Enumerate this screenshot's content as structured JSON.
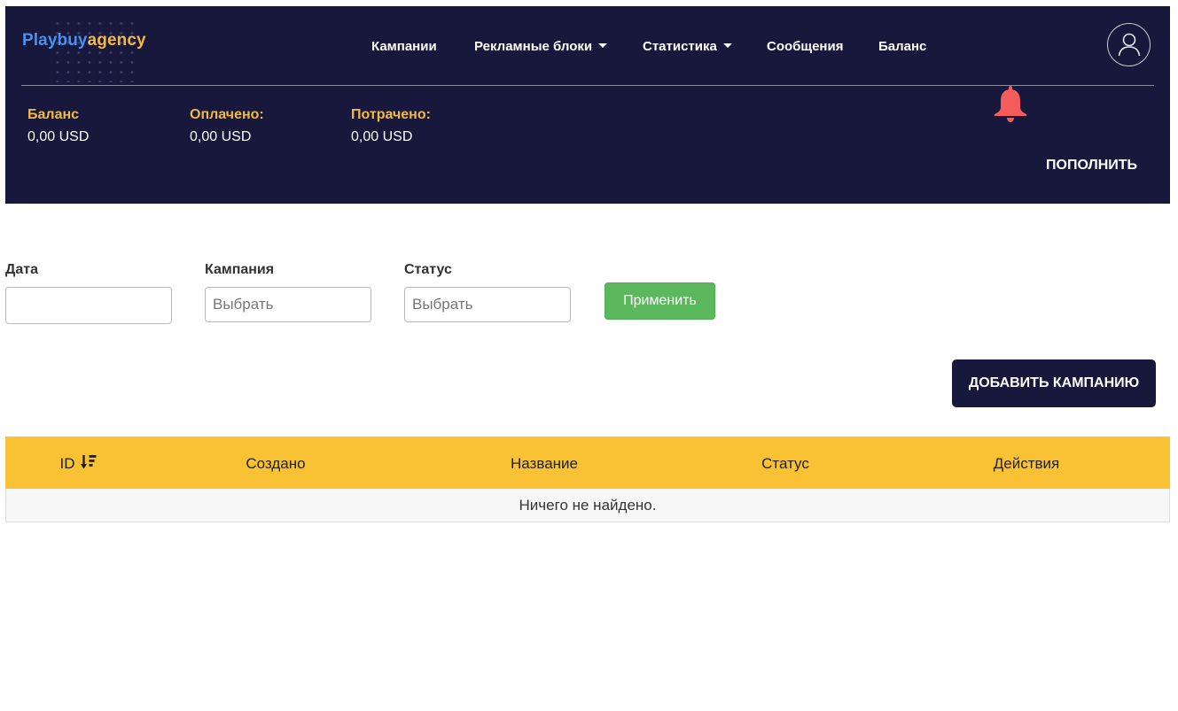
{
  "header": {
    "logo_part1": "Playbuy",
    "logo_part2": "agency",
    "nav": [
      {
        "label": "Кампании",
        "has_dropdown": false
      },
      {
        "label": "Рекламные блоки",
        "has_dropdown": true
      },
      {
        "label": "Статистика",
        "has_dropdown": true
      },
      {
        "label": "Сообщения",
        "has_dropdown": false
      },
      {
        "label": "Баланс",
        "has_dropdown": false
      }
    ],
    "avatar_icon": "user-icon",
    "notification_icon": "bell-icon",
    "stats": [
      {
        "label": "Баланс",
        "value": "0,00 USD"
      },
      {
        "label": "Оплачено:",
        "value": "0,00 USD"
      },
      {
        "label": "Потрачено:",
        "value": "0,00 USD"
      }
    ],
    "topup_label": "ПОПОЛНИТЬ"
  },
  "filters": {
    "date": {
      "label": "Дата",
      "value": "",
      "placeholder": ""
    },
    "campaign": {
      "label": "Кампания",
      "value": "",
      "placeholder": "Выбрать"
    },
    "status": {
      "label": "Статус",
      "value": "",
      "placeholder": "Выбрать"
    },
    "apply_label": "Применить"
  },
  "add_campaign_label": "ДОБАВИТЬ КАМПАНИЮ",
  "table": {
    "columns": [
      "ID",
      "Создано",
      "Название",
      "Статус",
      "Действия"
    ],
    "sort_icon": "sort-desc-icon",
    "empty_text": "Ничего не найдено."
  },
  "colors": {
    "header_bg": "#17183b",
    "accent_yellow": "#f4b942",
    "logo_blue": "#4a90f0",
    "table_header_bg": "#f8c234",
    "apply_green": "#5cb85c",
    "bell_red": "#f45b5b"
  }
}
